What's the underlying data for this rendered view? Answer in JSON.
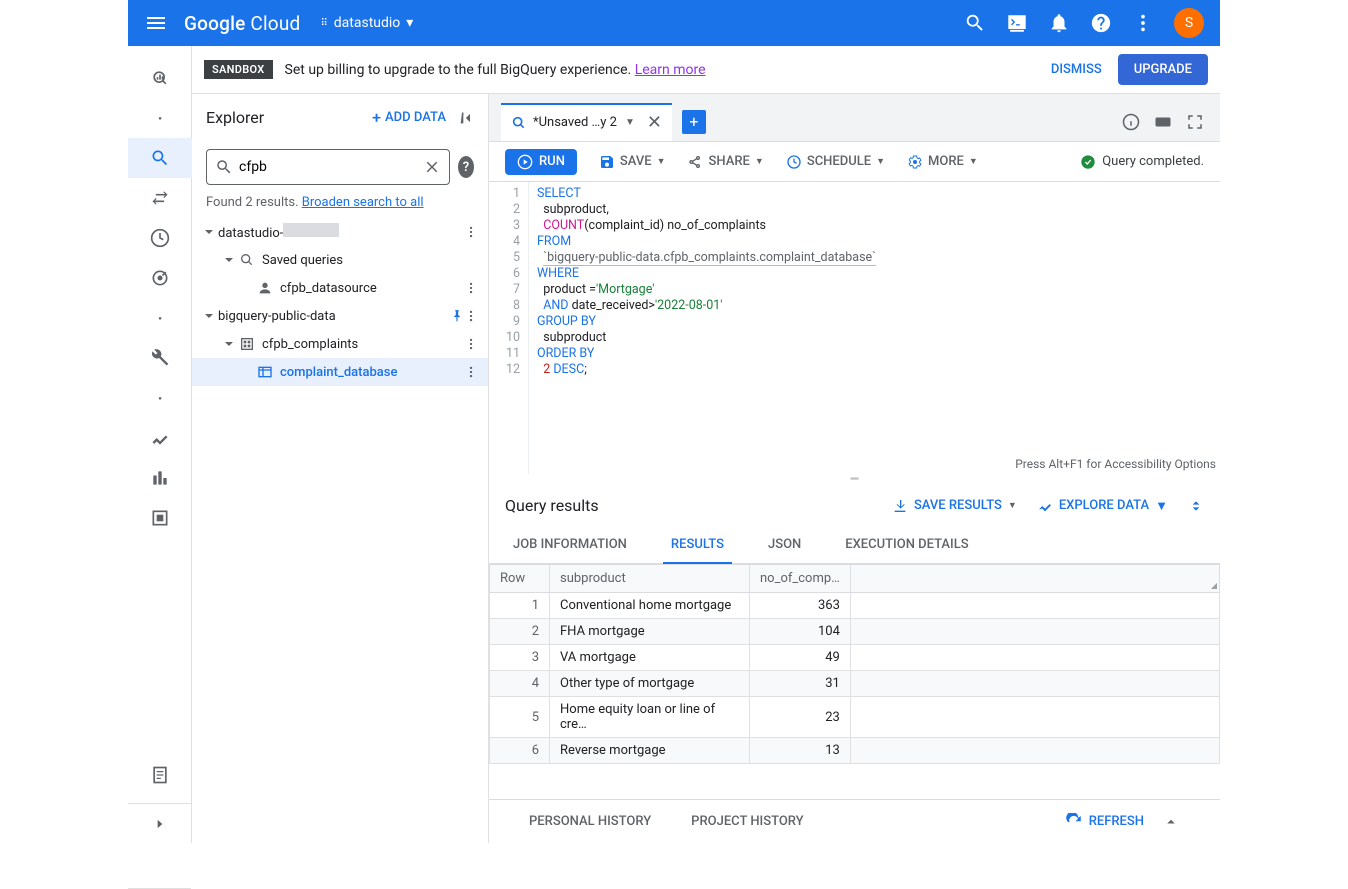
{
  "header": {
    "brand_bold": "Google",
    "brand_rest": " Cloud",
    "project_name": "datastudio",
    "avatar_letter": "S"
  },
  "notice": {
    "badge": "SANDBOX",
    "text": "Set up billing to upgrade to the full BigQuery experience. ",
    "link": "Learn more",
    "dismiss": "DISMISS",
    "upgrade": "UPGRADE"
  },
  "explorer": {
    "title": "Explorer",
    "add_data": "ADD DATA",
    "search_value": "cfpb",
    "results_text": "Found 2 results. ",
    "broaden_link": "Broaden search to all",
    "tree": {
      "proj_prefix": "datastudio-",
      "saved_queries": "Saved queries",
      "datasource": "cfpb_datasource",
      "public_data": "bigquery-public-data",
      "dataset": "cfpb_complaints",
      "table": "complaint_database"
    }
  },
  "tabs": {
    "tab_label": "*Unsaved …y 2"
  },
  "toolbar": {
    "run": "RUN",
    "save": "SAVE",
    "share": "SHARE",
    "schedule": "SCHEDULE",
    "more": "MORE",
    "status": "Query completed."
  },
  "editor": {
    "lines": [
      "SELECT",
      "  subproduct,",
      "  COUNT(complaint_id) no_of_complaints",
      "FROM",
      "  `bigquery-public-data.cfpb_complaints.complaint_database`",
      "WHERE",
      "  product ='Mortgage'",
      "  AND date_received>'2022-08-01'",
      "GROUP BY",
      "  subproduct",
      "ORDER BY",
      "  2 DESC;"
    ],
    "accessibility": "Press Alt+F1 for Accessibility Options"
  },
  "results": {
    "title": "Query results",
    "save_results": "SAVE RESULTS",
    "explore_data": "EXPLORE DATA",
    "tabs": [
      "JOB INFORMATION",
      "RESULTS",
      "JSON",
      "EXECUTION DETAILS"
    ],
    "columns": [
      "Row",
      "subproduct",
      "no_of_comp…"
    ],
    "rows": [
      {
        "n": 1,
        "sub": "Conventional home mortgage",
        "cnt": "363"
      },
      {
        "n": 2,
        "sub": "FHA mortgage",
        "cnt": "104"
      },
      {
        "n": 3,
        "sub": "VA mortgage",
        "cnt": "49"
      },
      {
        "n": 4,
        "sub": "Other type of mortgage",
        "cnt": "31"
      },
      {
        "n": 5,
        "sub": "Home equity loan or line of cre…",
        "cnt": "23"
      },
      {
        "n": 6,
        "sub": "Reverse mortgage",
        "cnt": "13"
      }
    ]
  },
  "history": {
    "personal": "PERSONAL HISTORY",
    "project": "PROJECT HISTORY",
    "refresh": "REFRESH"
  },
  "chart_data": {
    "type": "table",
    "title": "Query results",
    "columns": [
      "subproduct",
      "no_of_complaints"
    ],
    "rows": [
      [
        "Conventional home mortgage",
        363
      ],
      [
        "FHA mortgage",
        104
      ],
      [
        "VA mortgage",
        49
      ],
      [
        "Other type of mortgage",
        31
      ],
      [
        "Home equity loan or line of credit (HELOC)",
        23
      ],
      [
        "Reverse mortgage",
        13
      ]
    ]
  }
}
